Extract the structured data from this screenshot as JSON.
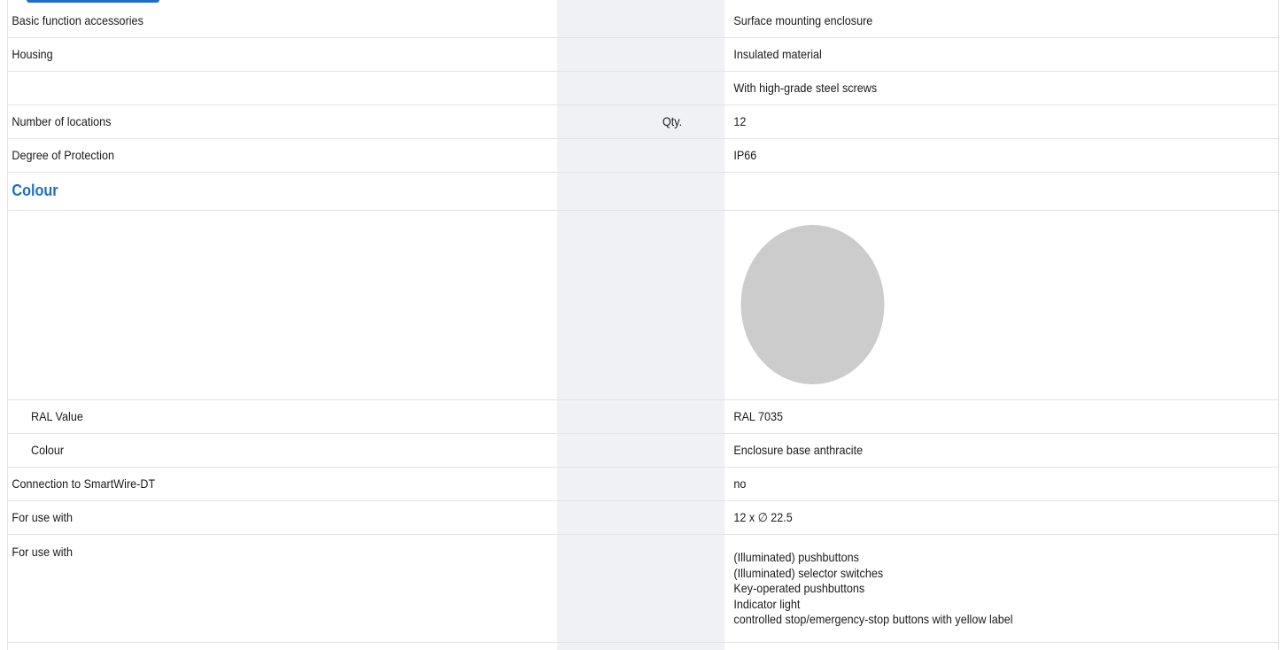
{
  "colors": {
    "accent": "#1e6fc4",
    "swatch": "#cccccc",
    "shade": "#f0f1f4",
    "border": "#e3e3e3"
  },
  "rows": [
    {
      "label": "Basic function accessories",
      "value": "Surface mounting enclosure"
    },
    {
      "label": "Housing",
      "value": "Insulated material"
    },
    {
      "label": "",
      "value": "With high-grade steel screws"
    },
    {
      "label": "Number of locations",
      "unit": "Qty.",
      "value": "12"
    },
    {
      "label": "Degree of Protection",
      "value": "IP66"
    }
  ],
  "colour_section": {
    "title": "Colour",
    "swatch_color": "RAL 7035",
    "ral_label": "RAL Value",
    "ral_value": "RAL 7035",
    "colour_label": "Colour",
    "colour_value": "Enclosure base anthracite"
  },
  "rows_after": [
    {
      "label": "Connection to SmartWire-DT",
      "value": "no"
    },
    {
      "label": "For use with",
      "value": "12 x ∅ 22.5"
    }
  ],
  "use_with": {
    "label": "For use with",
    "items": [
      "(Illuminated) pushbuttons",
      "(Illuminated) selector switches",
      "Key-operated pushbuttons",
      "Indicator light",
      "controlled stop/emergency-stop buttons with yellow label"
    ]
  }
}
